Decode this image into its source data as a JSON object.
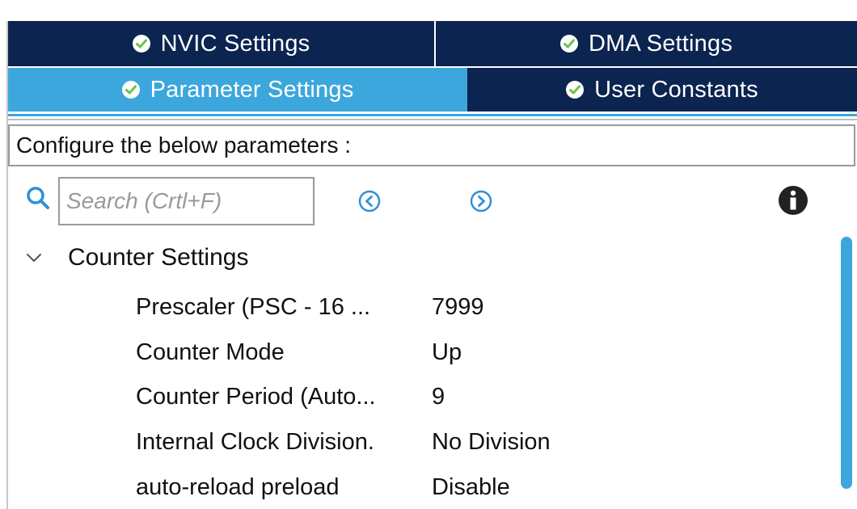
{
  "tabs": [
    {
      "label": "NVIC Settings",
      "icon": "check-circle-icon",
      "active": false
    },
    {
      "label": "DMA Settings",
      "icon": "check-circle-icon",
      "active": false
    },
    {
      "label": "Parameter Settings",
      "icon": "check-circle-icon",
      "active": true
    },
    {
      "label": "User Constants",
      "icon": "check-circle-icon",
      "active": false
    }
  ],
  "configure_label": "Configure the below parameters :",
  "search": {
    "placeholder": "Search (Crtl+F)",
    "value": "",
    "icon": "search-icon"
  },
  "toolbar": {
    "prev_icon": "chevron-left-circle-icon",
    "next_icon": "chevron-right-circle-icon",
    "info_icon": "info-icon"
  },
  "tree": {
    "group_label": "Counter Settings",
    "group_icon": "chevron-down-icon",
    "expanded": true,
    "rows": [
      {
        "name": "Prescaler (PSC - 16 ...",
        "value": "7999"
      },
      {
        "name": "Counter Mode",
        "value": "Up"
      },
      {
        "name": "Counter Period (Auto...",
        "value": "9"
      },
      {
        "name": "Internal Clock Division.",
        "value": "No Division"
      },
      {
        "name": "auto-reload preload",
        "value": "Disable"
      }
    ]
  },
  "colors": {
    "tab_dark": "#0b2450",
    "tab_active": "#3ba7dd",
    "check_green": "#6cc24a",
    "accent_blue": "#3ba7dd",
    "icon_dark": "#222222"
  }
}
